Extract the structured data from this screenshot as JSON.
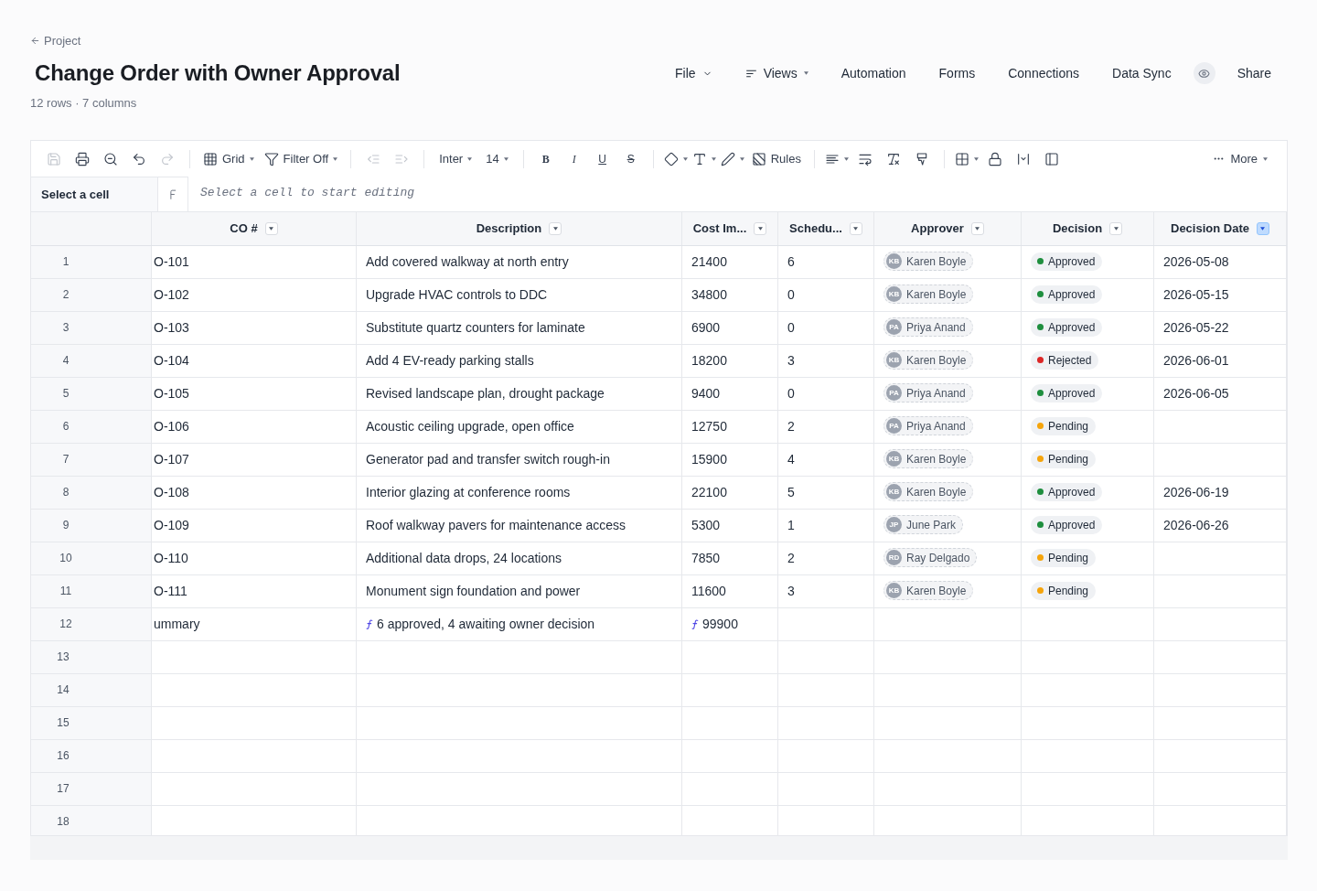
{
  "breadcrumb": {
    "label": "Project"
  },
  "title": "Change Order with Owner Approval",
  "subtitle": "12 rows · 7 columns",
  "nav": [
    {
      "label": "File"
    },
    {
      "label": "Views"
    },
    {
      "label": "Automation"
    },
    {
      "label": "Forms"
    },
    {
      "label": "Connections"
    },
    {
      "label": "Data Sync"
    }
  ],
  "share": {
    "label": "Share"
  },
  "toolbar": {
    "groups": [
      {
        "items": [
          {
            "disabled": true
          },
          {
            "disabled": false
          },
          {
            "disabled": false
          },
          {
            "disabled": false
          },
          {
            "disabled": true
          }
        ]
      },
      {
        "items": [
          {
            "label": "Grid",
            "disabled": false
          },
          {
            "label": "Filter Off",
            "disabled": false
          }
        ]
      },
      {
        "items": [
          {
            "disabled": true
          },
          {
            "disabled": true
          }
        ]
      },
      {
        "items": [
          {
            "label": "Inter",
            "disabled": false
          },
          {
            "label": "14",
            "disabled": false
          }
        ]
      },
      {
        "items": [
          {
            "label": "B",
            "disabled": false
          },
          {
            "label": "I",
            "disabled": false
          },
          {
            "label": "U",
            "disabled": false
          },
          {
            "label": "S",
            "disabled": false
          }
        ]
      },
      {
        "items": [
          {
            "disabled": false
          },
          {
            "disabled": false
          },
          {
            "disabled": false
          },
          {
            "label": "Rules",
            "disabled": false
          }
        ]
      },
      {
        "items": [
          {
            "disabled": false
          },
          {
            "disabled": false
          },
          {
            "disabled": false
          },
          {
            "disabled": false
          }
        ]
      },
      {
        "items": [
          {
            "disabled": false
          },
          {
            "disabled": false
          },
          {
            "disabled": false
          },
          {
            "disabled": false
          }
        ]
      }
    ],
    "more": {
      "label": "More"
    }
  },
  "formula_bar": {
    "cell_ref": "Select a cell",
    "placeholder": "Select a cell to start editing"
  },
  "columns": [
    {
      "label": "CO #",
      "active": false
    },
    {
      "label": "Description",
      "active": false
    },
    {
      "label": "Cost Im...",
      "active": false
    },
    {
      "label": "Schedu...",
      "active": false
    },
    {
      "label": "Approver",
      "active": false
    },
    {
      "label": "Decision",
      "active": false
    },
    {
      "label": "Decision Date",
      "active": true
    }
  ],
  "rows": [
    {
      "kind": "record",
      "number": "1",
      "co": "O-101",
      "description": "Add covered walkway at north entry",
      "cost": "21400",
      "schedule": "6",
      "approver": {
        "initials": "KB",
        "name": "Karen Boyle"
      },
      "decision": {
        "label": "Approved",
        "color": "#1e8e3e"
      },
      "decision_date": "2026-05-08"
    },
    {
      "kind": "record",
      "number": "2",
      "co": "O-102",
      "description": "Upgrade HVAC controls to DDC",
      "cost": "34800",
      "schedule": "0",
      "approver": {
        "initials": "KB",
        "name": "Karen Boyle"
      },
      "decision": {
        "label": "Approved",
        "color": "#1e8e3e"
      },
      "decision_date": "2026-05-15"
    },
    {
      "kind": "record",
      "number": "3",
      "co": "O-103",
      "description": "Substitute quartz counters for laminate",
      "cost": "6900",
      "schedule": "0",
      "approver": {
        "initials": "PA",
        "name": "Priya Anand"
      },
      "decision": {
        "label": "Approved",
        "color": "#1e8e3e"
      },
      "decision_date": "2026-05-22"
    },
    {
      "kind": "record",
      "number": "4",
      "co": "O-104",
      "description": "Add 4 EV-ready parking stalls",
      "cost": "18200",
      "schedule": "3",
      "approver": {
        "initials": "KB",
        "name": "Karen Boyle"
      },
      "decision": {
        "label": "Rejected",
        "color": "#dc2626"
      },
      "decision_date": "2026-06-01"
    },
    {
      "kind": "record",
      "number": "5",
      "co": "O-105",
      "description": "Revised landscape plan, drought package",
      "cost": "9400",
      "schedule": "0",
      "approver": {
        "initials": "PA",
        "name": "Priya Anand"
      },
      "decision": {
        "label": "Approved",
        "color": "#1e8e3e"
      },
      "decision_date": "2026-06-05"
    },
    {
      "kind": "record",
      "number": "6",
      "co": "O-106",
      "description": "Acoustic ceiling upgrade, open office",
      "cost": "12750",
      "schedule": "2",
      "approver": {
        "initials": "PA",
        "name": "Priya Anand"
      },
      "decision": {
        "label": "Pending",
        "color": "#f5a40b"
      }
    },
    {
      "kind": "record",
      "number": "7",
      "co": "O-107",
      "description": "Generator pad and transfer switch rough-in",
      "cost": "15900",
      "schedule": "4",
      "approver": {
        "initials": "KB",
        "name": "Karen Boyle"
      },
      "decision": {
        "label": "Pending",
        "color": "#f5a40b"
      }
    },
    {
      "kind": "record",
      "number": "8",
      "co": "O-108",
      "description": "Interior glazing at conference rooms",
      "cost": "22100",
      "schedule": "5",
      "approver": {
        "initials": "KB",
        "name": "Karen Boyle"
      },
      "decision": {
        "label": "Approved",
        "color": "#1e8e3e"
      },
      "decision_date": "2026-06-19"
    },
    {
      "kind": "record",
      "number": "9",
      "co": "O-109",
      "description": "Roof walkway pavers for maintenance access",
      "cost": "5300",
      "schedule": "1",
      "approver": {
        "initials": "JP",
        "name": "June Park"
      },
      "decision": {
        "label": "Approved",
        "color": "#1e8e3e"
      },
      "decision_date": "2026-06-26"
    },
    {
      "kind": "record",
      "number": "10",
      "co": "O-110",
      "description": "Additional data drops, 24 locations",
      "cost": "7850",
      "schedule": "2",
      "approver": {
        "initials": "RD",
        "name": "Ray Delgado"
      },
      "decision": {
        "label": "Pending",
        "color": "#f5a40b"
      }
    },
    {
      "kind": "record",
      "number": "11",
      "co": "O-111",
      "description": "Monument sign foundation and power",
      "cost": "11600",
      "schedule": "3",
      "approver": {
        "initials": "KB",
        "name": "Karen Boyle"
      },
      "decision": {
        "label": "Pending",
        "color": "#f5a40b"
      }
    },
    {
      "kind": "summary",
      "number": "12",
      "co": "ummary",
      "description": "6 approved, 4 awaiting owner decision",
      "cost": "99900"
    }
  ],
  "empty_rows": [
    "13",
    "14",
    "15",
    "16",
    "17",
    "18"
  ]
}
